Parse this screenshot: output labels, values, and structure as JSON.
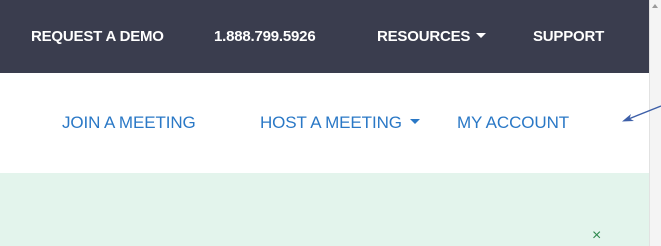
{
  "topbar": {
    "request_demo": "REQUEST A DEMO",
    "phone": "1.888.799.5926",
    "resources": "RESOURCES",
    "support": "SUPPORT"
  },
  "subnav": {
    "join_meeting": "JOIN A MEETING",
    "host_meeting": "HOST A MEETING",
    "my_account": "MY ACCOUNT"
  },
  "alert": {
    "close_symbol": "×"
  },
  "icons": {
    "resources_dropdown": "caret-down-icon",
    "host_dropdown": "caret-down-icon",
    "alert_close": "close-icon",
    "annotation": "arrow-icon"
  },
  "colors": {
    "topbar_bg": "#3a3d4e",
    "link_blue": "#2a78c6",
    "alert_bg": "#e3f4ec",
    "alert_close": "#2e8a4e",
    "annotation_arrow": "#3d5fa8"
  }
}
